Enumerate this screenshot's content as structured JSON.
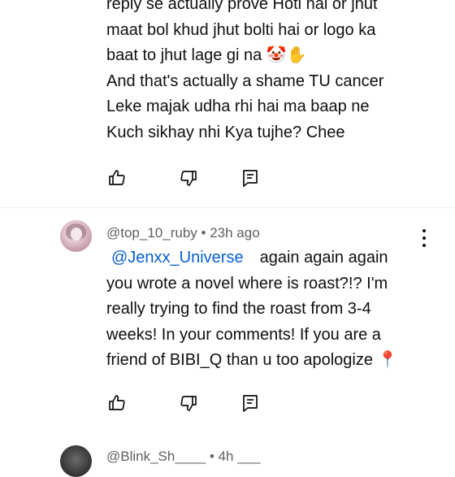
{
  "comment_1": {
    "lines": [
      "reply se actually prove Hoti hai or jhut",
      "maat bol khud jhut bolti hai or logo ka",
      "baat to jhut lage gi na 🤡✋",
      "And that's actually a shame TU cancer",
      "Leke majak udha rhi hai ma baap ne",
      "Kuch sikhay nhi Kya tujhe? Chee"
    ],
    "actions": {
      "like_icon": "thumbs-up-icon",
      "dislike_icon": "thumbs-down-icon",
      "reply_icon": "reply-comment-icon"
    }
  },
  "comment_2": {
    "author": "@top_10_ruby",
    "separator": "•",
    "timestamp": "23h ago",
    "mention": "@Jenxx_Universe",
    "lines_first": "again again again",
    "lines": [
      "you wrote a novel where is roast?!? I'm",
      "really trying to find the roast from 3-4",
      "weeks! In your comments! If you are a",
      "friend of BIBI_Q than u too apologize 📍"
    ],
    "actions": {
      "like_icon": "thumbs-up-icon",
      "dislike_icon": "thumbs-down-icon",
      "reply_icon": "reply-comment-icon"
    }
  },
  "comment_3": {
    "author_partial": "@Blink_Sh____ • 4h ___"
  },
  "colors": {
    "mention": "#065fd4",
    "meta": "#606060",
    "text": "#0f0f0f"
  }
}
